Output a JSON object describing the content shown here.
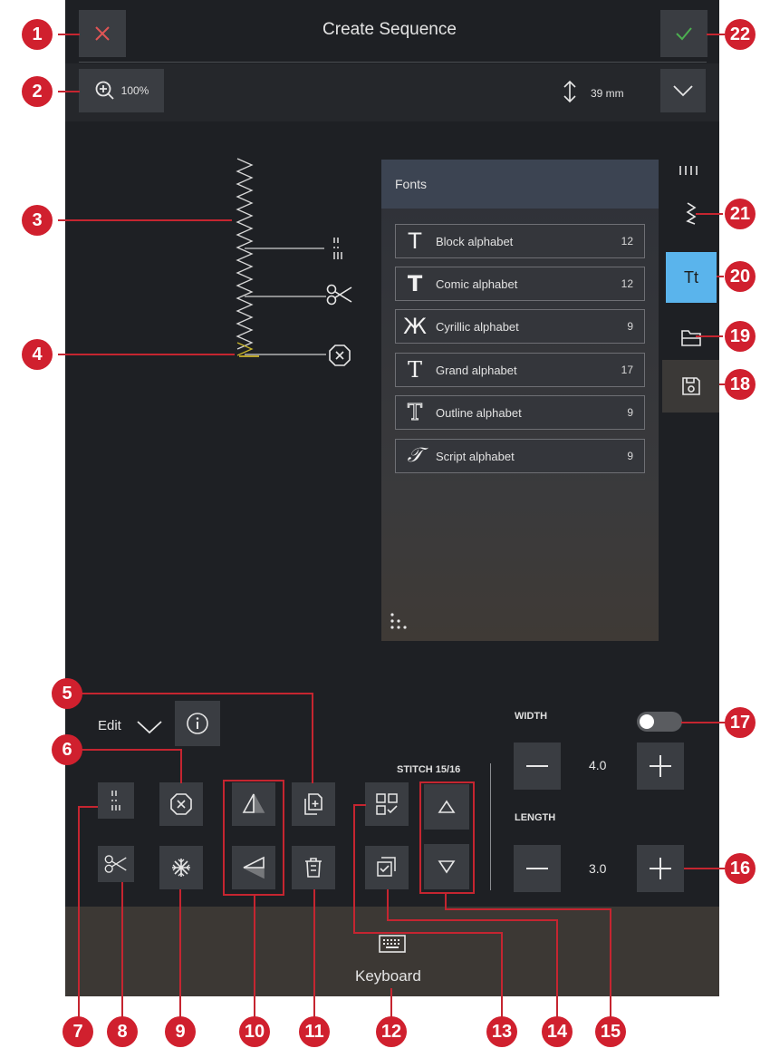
{
  "header": {
    "title": "Create Sequence"
  },
  "zoom": {
    "value": "100%"
  },
  "height_readout": {
    "value": "39 mm"
  },
  "fonts": {
    "heading": "Fonts",
    "items": [
      {
        "icon": "T",
        "label": "Block alphabet",
        "count": "12"
      },
      {
        "icon": "T",
        "label": "Comic alphabet",
        "count": "12"
      },
      {
        "icon": "Ж",
        "label": "Cyrillic alphabet",
        "count": "9"
      },
      {
        "icon": "T",
        "label": "Grand alphabet",
        "count": "17"
      },
      {
        "icon": "T",
        "label": "Outline alphabet",
        "count": "9"
      },
      {
        "icon": "𝒯",
        "label": "Script alphabet",
        "count": "9"
      }
    ]
  },
  "edit": {
    "label": "Edit"
  },
  "stitch": {
    "label": "STITCH 15/16"
  },
  "width": {
    "label": "WIDTH",
    "value": "4.0",
    "toggle_on": false
  },
  "length": {
    "label": "LENGTH",
    "value": "3.0"
  },
  "keyboard": {
    "label": "Keyboard"
  },
  "colors": {
    "accent": "#5ab4ec",
    "callout": "#d0202e",
    "confirm": "#4caf50",
    "cancel": "#e05555"
  },
  "callouts": [
    "1",
    "2",
    "3",
    "4",
    "5",
    "6",
    "7",
    "8",
    "9",
    "10",
    "11",
    "12",
    "13",
    "14",
    "15",
    "16",
    "17",
    "18",
    "19",
    "20",
    "21",
    "22"
  ]
}
